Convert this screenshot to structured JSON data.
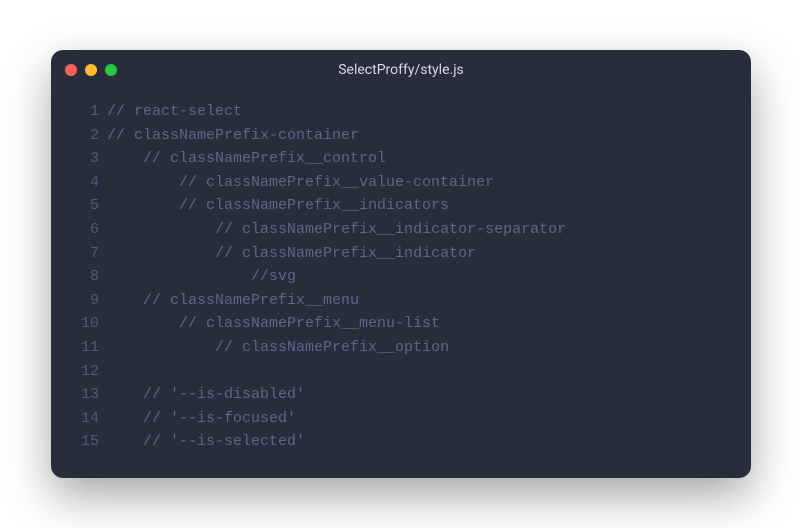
{
  "window": {
    "title": "SelectProffy/style.js",
    "traffic_colors": {
      "close": "#ff5f57",
      "minimize": "#febc2e",
      "zoom": "#28c840"
    }
  },
  "code": {
    "lines": [
      {
        "num": "1",
        "indent": "",
        "text": "// react-select"
      },
      {
        "num": "2",
        "indent": "",
        "text": "// classNamePrefix-container"
      },
      {
        "num": "3",
        "indent": "    ",
        "text": "// classNamePrefix__control"
      },
      {
        "num": "4",
        "indent": "        ",
        "text": "// classNamePrefix__value-container"
      },
      {
        "num": "5",
        "indent": "        ",
        "text": "// classNamePrefix__indicators"
      },
      {
        "num": "6",
        "indent": "            ",
        "text": "// classNamePrefix__indicator-separator"
      },
      {
        "num": "7",
        "indent": "            ",
        "text": "// classNamePrefix__indicator"
      },
      {
        "num": "8",
        "indent": "                ",
        "text": "//svg"
      },
      {
        "num": "9",
        "indent": "    ",
        "text": "// classNamePrefix__menu"
      },
      {
        "num": "10",
        "indent": "        ",
        "text": "// classNamePrefix__menu-list"
      },
      {
        "num": "11",
        "indent": "            ",
        "text": "// classNamePrefix__option"
      },
      {
        "num": "12",
        "indent": "",
        "text": ""
      },
      {
        "num": "13",
        "indent": "    ",
        "text": "// '--is-disabled'"
      },
      {
        "num": "14",
        "indent": "    ",
        "text": "// '--is-focused'"
      },
      {
        "num": "15",
        "indent": "    ",
        "text": "// '--is-selected'"
      }
    ]
  }
}
